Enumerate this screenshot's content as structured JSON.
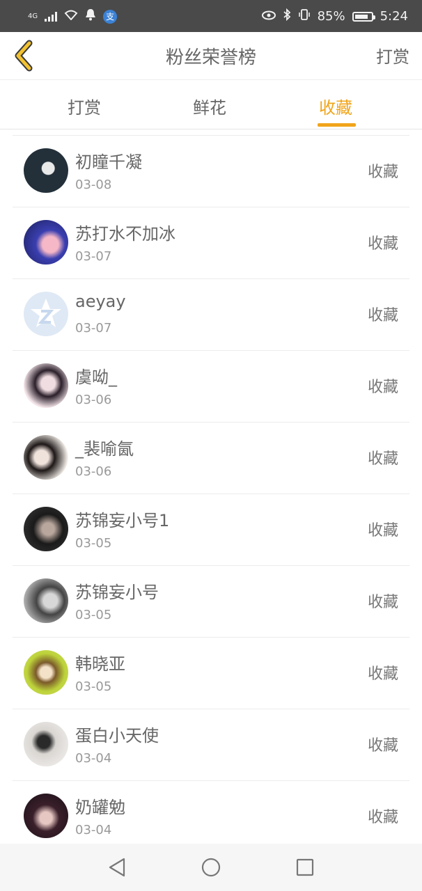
{
  "status_bar": {
    "signal": "4G",
    "battery": "85%",
    "time": "5:24",
    "qq_badge": "支"
  },
  "header": {
    "title": "粉丝荣誉榜",
    "action": "打赏"
  },
  "tabs": [
    {
      "label": "打赏",
      "active": false
    },
    {
      "label": "鲜花",
      "active": false
    },
    {
      "label": "收藏",
      "active": true
    }
  ],
  "accent_color": "#f0a51b",
  "items": [
    {
      "name": "初瞳千凝",
      "date": "03-08",
      "action": "收藏"
    },
    {
      "name": "苏打水不加冰",
      "date": "03-07",
      "action": "收藏"
    },
    {
      "name": "aeyay",
      "date": "03-07",
      "action": "收藏"
    },
    {
      "name": "虞呦_",
      "date": "03-06",
      "action": "收藏"
    },
    {
      "name": "_裴喻氤",
      "date": "03-06",
      "action": "收藏"
    },
    {
      "name": "苏锦妄小号1",
      "date": "03-05",
      "action": "收藏"
    },
    {
      "name": "苏锦妄小号",
      "date": "03-05",
      "action": "收藏"
    },
    {
      "name": "韩晓亚",
      "date": "03-05",
      "action": "收藏"
    },
    {
      "name": "蛋白小天使",
      "date": "03-04",
      "action": "收藏"
    },
    {
      "name": "奶罐勉",
      "date": "03-04",
      "action": "收藏"
    }
  ]
}
